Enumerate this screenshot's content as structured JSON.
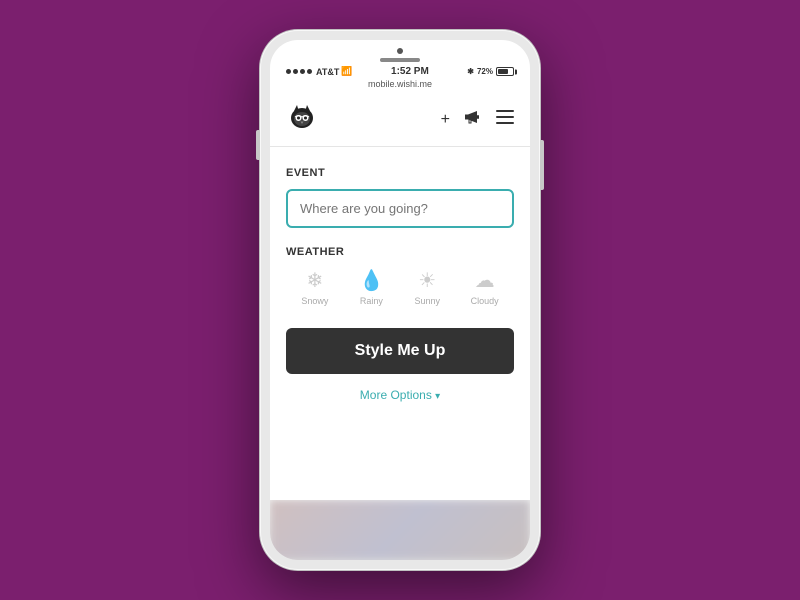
{
  "background_color": "#7b1f6e",
  "phone": {
    "status_bar": {
      "signal_dots": 4,
      "carrier": "AT&T",
      "wifi": "⌘",
      "time": "1:52 PM",
      "bluetooth": "✦",
      "battery_percent": "72%"
    },
    "url": "mobile.wishi.me",
    "nav": {
      "logo_alt": "Wishi owl logo",
      "add_icon": "+",
      "megaphone_icon": "📣",
      "menu_icon": "☰"
    },
    "event": {
      "section_label": "EVENT",
      "input_placeholder": "Where are you going?"
    },
    "weather": {
      "section_label": "WEATHER",
      "options": [
        {
          "id": "snowy",
          "icon": "❄",
          "label": "Snowy"
        },
        {
          "id": "rainy",
          "icon": "💧",
          "label": "Rainy"
        },
        {
          "id": "sunny",
          "icon": "☀",
          "label": "Sunny"
        },
        {
          "id": "cloudy",
          "icon": "☁",
          "label": "Cloudy"
        }
      ]
    },
    "style_button": {
      "label": "Style Me Up"
    },
    "more_options": {
      "label": "More Options",
      "chevron": "▾"
    }
  }
}
